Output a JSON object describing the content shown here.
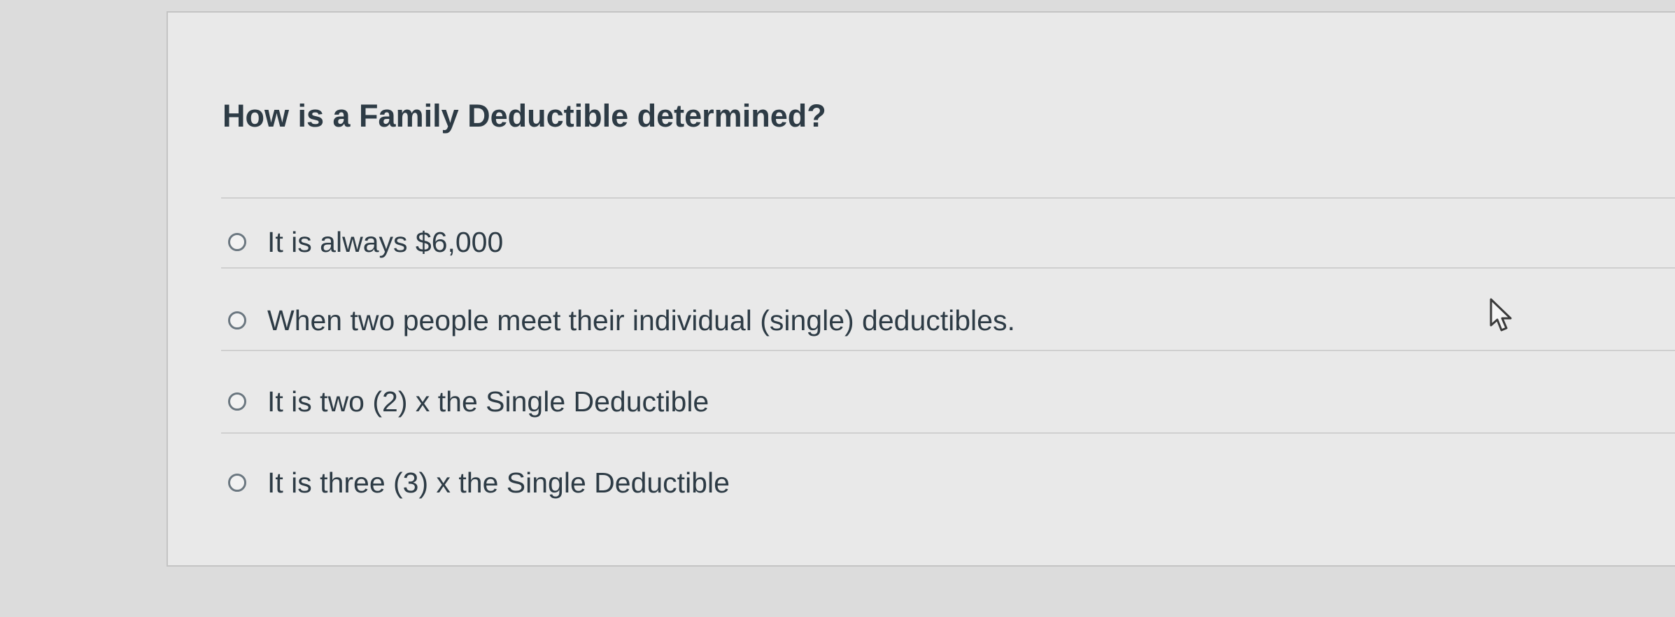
{
  "question": {
    "text": "How is a Family Deductible determined?"
  },
  "answers": [
    {
      "label": "It is always $6,000",
      "selected": false
    },
    {
      "label": "When two people meet their individual (single) deductibles.",
      "selected": false
    },
    {
      "label": "It is two (2) x the Single Deductible",
      "selected": false
    },
    {
      "label": "It is three (3) x the Single Deductible",
      "selected": false
    }
  ],
  "icons": {
    "radio": "radio-unchecked-icon",
    "cursor": "mouse-pointer-icon"
  },
  "colors": {
    "text": "#2d3b45",
    "radio_border": "#6b7780",
    "card_background": "#e9e9e9",
    "page_background": "#dcdcdc"
  }
}
